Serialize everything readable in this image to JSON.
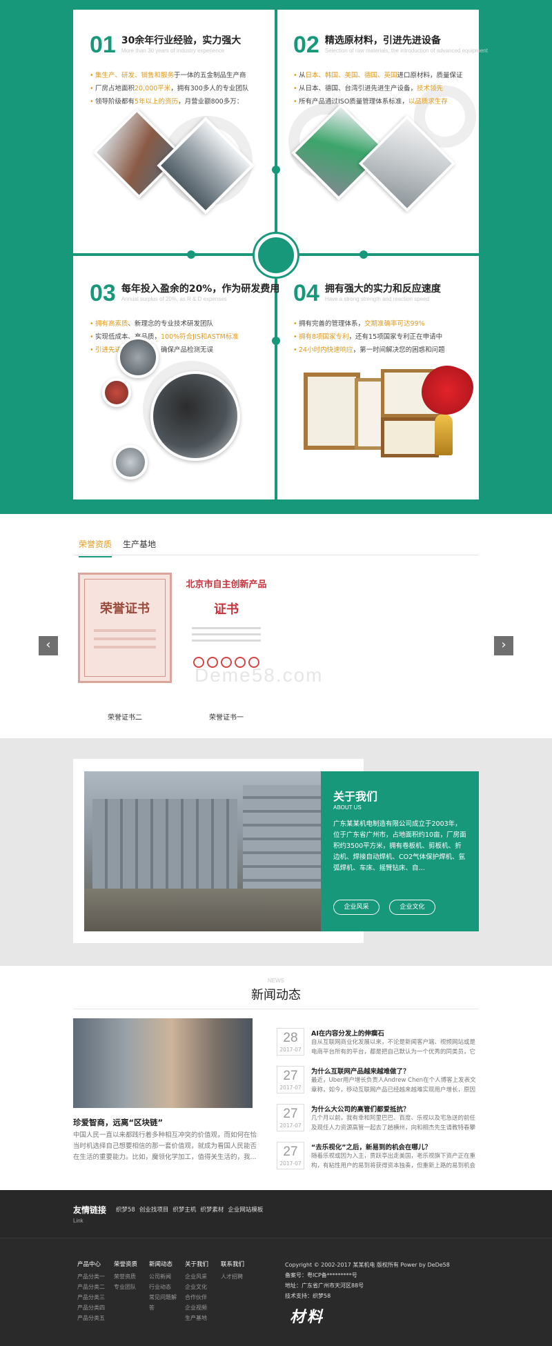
{
  "advantages": {
    "items": [
      {
        "num": "01",
        "title": "30余年行业经验，实力强大",
        "subtitle": "More than 30 years of industry experience",
        "bullets": [
          {
            "pre": "",
            "hl": "集生产、研发、销售和服务",
            "post": "于一体的五金制品生产商"
          },
          {
            "pre": "厂房占地面积",
            "hl": "20,000平米",
            "post": "，拥有300多人的专业团队"
          },
          {
            "pre": "领导阶级都有",
            "hl": "5年以上的资历",
            "post": "，月营业额800多万："
          }
        ]
      },
      {
        "num": "02",
        "title": "精选原材料，引进先进设备",
        "subtitle": "Selection of raw materials, the introduction of advanced equipment",
        "bullets": [
          {
            "pre": "从",
            "hl": "日本、韩国、美国、德国、英国",
            "post": "进口原材料，质量保证"
          },
          {
            "pre": "从日本、德国、台湾引进先进生产设备，",
            "hl": "技术领先",
            "post": ""
          },
          {
            "pre": "所有产品通过ISO质量管理体系标准，",
            "hl": "以品质求生存",
            "post": ""
          }
        ]
      },
      {
        "num": "03",
        "title": "每年投入盈余的20%，作为研发费用",
        "subtitle": "Annual surplus of 20%, as R & D expenses",
        "bullets": [
          {
            "pre": "",
            "hl": "拥有高素质",
            "post": "、新理念的专业技术研发团队"
          },
          {
            "pre": "实现低成本、高品质，",
            "hl": "100%符合JIS和ASTM标准",
            "post": ""
          },
          {
            "pre": "",
            "hl": "引进先进的检测设备",
            "post": "，确保产品检测无误"
          }
        ]
      },
      {
        "num": "04",
        "title": "拥有强大的实力和反应速度",
        "subtitle": "Have a strong strength and reaction speed",
        "bullets": [
          {
            "pre": "拥有完善的管理体系，",
            "hl": "交期准确率可达99%",
            "post": ""
          },
          {
            "pre": "",
            "hl": "拥有8项国家专利",
            "post": "，还有15项国家专利正在申请中"
          },
          {
            "pre": "",
            "hl": "24小时内快速响应",
            "post": "，第一时间解决您的困惑和问题"
          }
        ]
      }
    ]
  },
  "honors": {
    "tabs": [
      "荣誉资质",
      "生产基地"
    ],
    "certs": [
      {
        "caption": "荣誉证书二",
        "heading": "荣誉证书"
      },
      {
        "caption": "荣誉证书一",
        "heading": "北京市自主创新产品",
        "sub": "证书"
      }
    ],
    "watermark": "Deme58.com",
    "prev_icon": "‹",
    "next_icon": "›"
  },
  "about": {
    "title": "关于我们",
    "subtitle": "ABOUT US",
    "text": "广东某某机电制造有限公司成立于2003年，位于广东省广州市，占地面积约10亩，厂房面积约3500平方米，拥有卷板机、剪板机、折边机、焊接自动焊机、CO2气体保护焊机、氩弧焊机、车床、摇臂钻床、自…",
    "buttons": [
      "企业风采",
      "企业文化"
    ]
  },
  "news": {
    "en": "NEWS",
    "title": "新闻动态",
    "featured": {
      "title": "珍爱智商，远离“区块链”",
      "desc": "中国人民一直以来都践行着多种相互冲突的价值观，而如何在恰当时机选择自己想要相信的那一套价值观，就成为看国人民能否在生活的重要能力。比如，魔领化学加工，值得关生活的，我..."
    },
    "items": [
      {
        "day": "28",
        "ym": "2017-07",
        "title": "AI在内容分发上的伸瘸石",
        "desc": "自从互联网商业化发展以来，不论是新闻客户端、视频网站或是电商平台所有的平台，都是把自己默认为一个优秀的同类员，它按照"
      },
      {
        "day": "27",
        "ym": "2017-07",
        "title": "为什么互联网产品越来越难做了？",
        "desc": "最近，Uber用户增长负责人Andrew Chen在个人博客上发表文章称，如今，移动互联网产品已经越来越难实现用户增长，原因就在"
      },
      {
        "day": "27",
        "ym": "2017-07",
        "title": "为什么大公司的高管们都爱抵抗？",
        "desc": "几个月以前，我有幸和阿里巴巴、百度、乐视以及宅急送的前任及现任人力资源高管一起去了趟横州，向和相杰先生请教特春攀的基"
      },
      {
        "day": "27",
        "ym": "2017-07",
        "title": "“去乐视化”之后，新易到的机会在哪儿？",
        "desc": "随着乐视或因为入主，贾跃亭出走美国，老乐视旗下资产正在重构，有粘性用户的易到将获得资本独奏，但重新上路的易到机会"
      }
    ]
  },
  "footer": {
    "links_title": "友情链接",
    "links_sub": "Link",
    "links": [
      "织梦58",
      "创业找项目",
      "织梦主机",
      "织梦素材",
      "企业网站模板"
    ],
    "columns": [
      {
        "head": "产品中心",
        "items": [
          "产品分类一",
          "产品分类二",
          "产品分类三",
          "产品分类四",
          "产品分类五"
        ]
      },
      {
        "head": "荣誉资质",
        "items": [
          "荣誉资质",
          "专业团队"
        ]
      },
      {
        "head": "新闻动态",
        "items": [
          "公司新闻",
          "行业动态",
          "常见问题解",
          "答"
        ]
      },
      {
        "head": "关于我们",
        "items": [
          "企业风采",
          "企业文化",
          "合作伙伴",
          "企业视频",
          "生产基地"
        ]
      },
      {
        "head": "联系我们",
        "items": [
          "人才招聘"
        ]
      }
    ],
    "copyright": [
      "Copyright © 2002-2017 某某机电 版权所有 Power by DeDe58",
      "备案号：粤ICP备*********号",
      "地址：广东省广州市天河区88号",
      "技术支持：织梦58"
    ],
    "logo_text": "材料"
  },
  "colors": {
    "brand_green": "#17987a",
    "accent_orange": "#e09a1c"
  }
}
